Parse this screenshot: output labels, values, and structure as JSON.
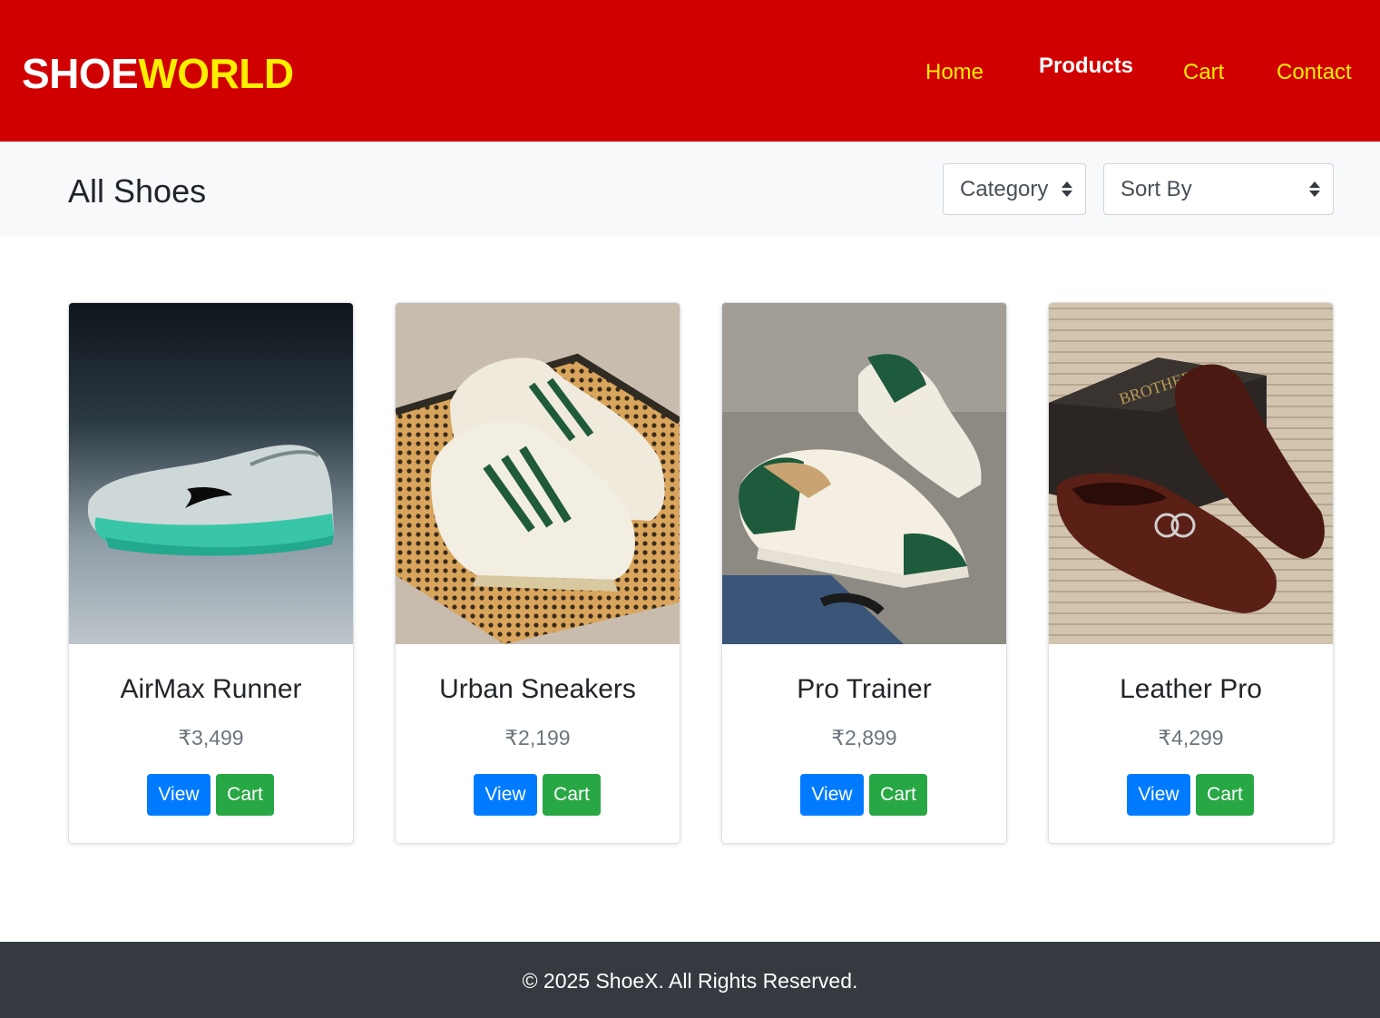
{
  "header": {
    "logo_part1": "SHOE",
    "logo_part2": "WORLD",
    "nav": [
      "Home",
      "Products",
      "Cart",
      "Contact"
    ],
    "active_nav": "Products"
  },
  "filter_bar": {
    "title": "All Shoes",
    "category_select": "Category",
    "sort_select": "Sort By"
  },
  "products": [
    {
      "name": "AirMax Runner",
      "price": "₹3,499",
      "view_label": "View",
      "cart_label": "Cart",
      "image": "teal-running-shoe"
    },
    {
      "name": "Urban Sneakers",
      "price": "₹2,199",
      "view_label": "View",
      "cart_label": "Cart",
      "image": "white-green-striped-sneakers"
    },
    {
      "name": "Pro Trainer",
      "price": "₹2,899",
      "view_label": "View",
      "cart_label": "Cart",
      "image": "green-cream-trainers"
    },
    {
      "name": "Leather Pro",
      "price": "₹4,299",
      "view_label": "View",
      "cart_label": "Cart",
      "image": "brown-leather-loafers"
    }
  ],
  "footer": {
    "text": "© 2025 ShoeX. All Rights Reserved."
  },
  "colors": {
    "header_bg": "#d10000",
    "logo_accent": "#ffee00",
    "view_button": "#007bff",
    "cart_button": "#28a745",
    "footer_bg": "#343a40"
  }
}
